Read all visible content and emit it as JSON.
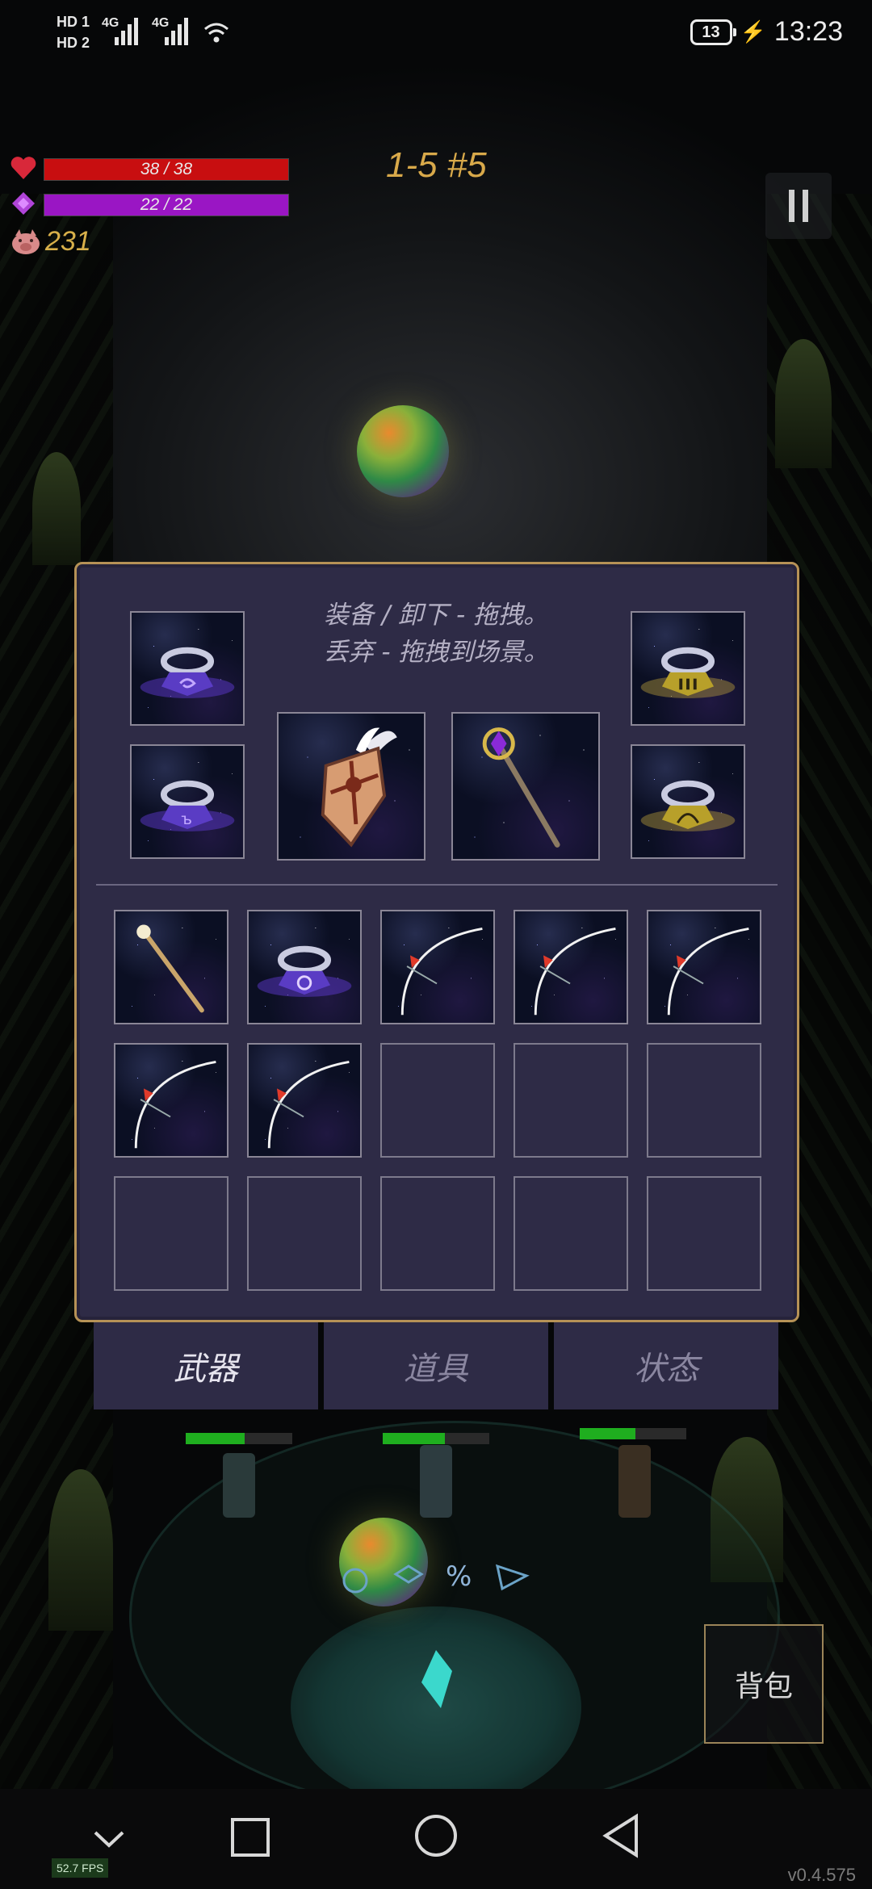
{
  "status_bar": {
    "hd1": "HD 1",
    "hd2": "HD 2",
    "net1": "4G",
    "net2": "4G",
    "battery": "13",
    "time": "13:23"
  },
  "hud": {
    "hp_text": "38 / 38",
    "mp_text": "22 / 22",
    "coins": "231",
    "stage": "1-5 #5",
    "hp_fill": 1.0,
    "mp_fill": 1.0,
    "colors": {
      "hp": "#c80e10",
      "mp": "#9a16c4",
      "gold": "#d8a94a"
    }
  },
  "inventory": {
    "instruction_line1": "装备 / 卸下 - 拖拽。",
    "instruction_line2": "丢弃 - 拖拽到场景。",
    "equipped": [
      {
        "slot": "ring-1",
        "item": "purple-spiral-ring"
      },
      {
        "slot": "ring-2",
        "item": "purple-rune-ring"
      },
      {
        "slot": "shield",
        "item": "winged-shield"
      },
      {
        "slot": "weapon",
        "item": "purple-gem-staff"
      },
      {
        "slot": "ring-3",
        "item": "gold-bar-ring"
      },
      {
        "slot": "ring-4",
        "item": "gold-shell-ring"
      }
    ],
    "bag": [
      "golden-staff",
      "purple-flower-ring",
      "white-bow",
      "white-bow",
      "white-bow",
      "white-bow",
      "white-bow",
      "",
      "",
      "",
      "",
      "",
      "",
      "",
      ""
    ]
  },
  "tabs": [
    {
      "label": "武器",
      "active": true
    },
    {
      "label": "道具",
      "active": false
    },
    {
      "label": "状态",
      "active": false
    }
  ],
  "bag_button": "背包",
  "fps": "52.7 FPS",
  "version": "v0.4.575"
}
